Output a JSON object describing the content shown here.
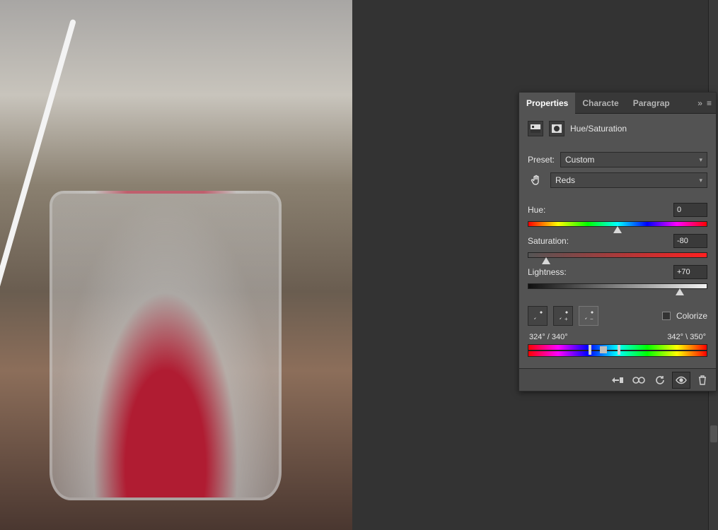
{
  "tabs": {
    "properties": "Properties",
    "character": "Characte",
    "paragraph": "Paragrap"
  },
  "panel": {
    "adjustment_name": "Hue/Saturation",
    "preset_label": "Preset:",
    "preset_value": "Custom",
    "channel_value": "Reds",
    "hue": {
      "label": "Hue:",
      "value": "0",
      "position_pct": 50
    },
    "saturation": {
      "label": "Saturation:",
      "value": "-80",
      "position_pct": 10
    },
    "lightness": {
      "label": "Lightness:",
      "value": "+70",
      "position_pct": 85
    },
    "colorize_label": "Colorize",
    "colorize_checked": false,
    "range_left": "324° / 340°",
    "range_right": "342° \\ 350°",
    "range_marks_pct": {
      "outerL": 34,
      "innerL": 40,
      "innerR": 44,
      "outerR": 50
    }
  }
}
